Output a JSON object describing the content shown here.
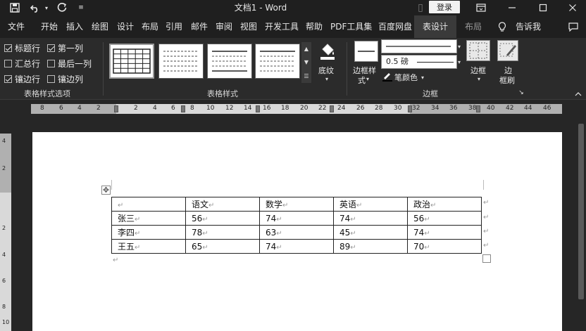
{
  "titlebar": {
    "doc_title": "文档1  -  Word",
    "login_label": "登录"
  },
  "tabs": [
    {
      "label": "文件"
    },
    {
      "label": "开始"
    },
    {
      "label": "插入"
    },
    {
      "label": "绘图"
    },
    {
      "label": "设计"
    },
    {
      "label": "布局"
    },
    {
      "label": "引用"
    },
    {
      "label": "邮件"
    },
    {
      "label": "审阅"
    },
    {
      "label": "视图"
    },
    {
      "label": "开发工具"
    },
    {
      "label": "帮助"
    },
    {
      "label": "PDF工具集"
    },
    {
      "label": "百度网盘"
    },
    {
      "label": "表设计"
    },
    {
      "label": "布局"
    },
    {
      "label": "告诉我"
    }
  ],
  "ribbon": {
    "style_options": {
      "header_row": "标题行",
      "first_column": "第一列",
      "total_row": "汇总行",
      "last_column": "最后一列",
      "banded_rows": "镶边行",
      "banded_columns": "镶边列",
      "group_label": "表格样式选项"
    },
    "table_styles": {
      "group_label": "表格样式",
      "shading_label": "底纹"
    },
    "borders": {
      "border_styles_label_1": "边框样",
      "border_styles_label_2": "式",
      "pen_weight": "0.5 磅",
      "pen_color_label": "笔颜色",
      "borders_label": "边框",
      "border_painter_label_1": "边",
      "border_painter_label_2": "框刷",
      "group_label": "边框"
    }
  },
  "ruler": {
    "numbers": [
      "8",
      "6",
      "4",
      "2",
      "2",
      "4",
      "6",
      "8",
      "10",
      "12",
      "14",
      "16",
      "18",
      "20",
      "22",
      "24",
      "26",
      "28",
      "30",
      "32",
      "34",
      "36",
      "38",
      "40",
      "42",
      "44",
      "46"
    ]
  },
  "vruler": {
    "numbers": [
      "4",
      "2",
      "2",
      "4",
      "6",
      "8",
      "10"
    ]
  },
  "table": {
    "rows": [
      [
        "",
        "语文",
        "数学",
        "英语",
        "政治"
      ],
      [
        "张三",
        "56",
        "74",
        "74",
        "56"
      ],
      [
        "李四",
        "78",
        "63",
        "45",
        "74"
      ],
      [
        "王五",
        "65",
        "74",
        "89",
        "70"
      ]
    ],
    "cell_mark": "↵"
  },
  "icons": {
    "save": "save-icon",
    "undo": "undo-icon",
    "redo": "redo-icon",
    "customize": "customize-icon",
    "ribbon_display": "ribbon-display-icon",
    "minimize": "minimize-icon",
    "maximize": "maximize-icon",
    "close": "close-icon",
    "tell_me": "lightbulb-icon",
    "comments": "comment-icon"
  }
}
